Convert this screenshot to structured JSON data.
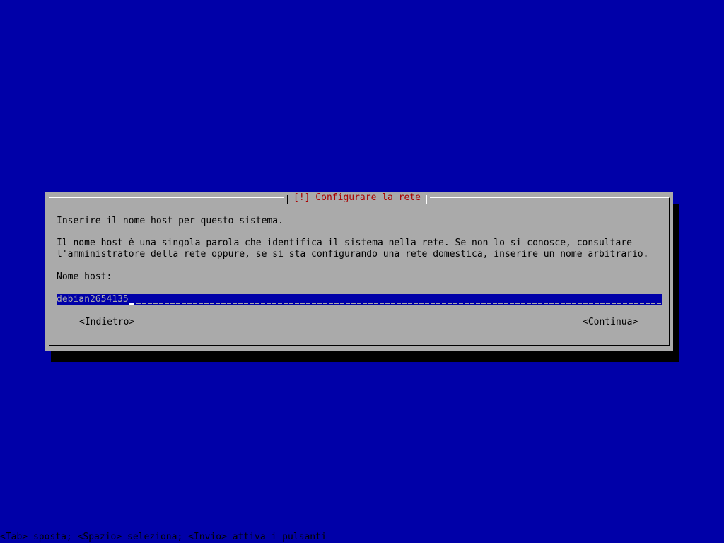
{
  "dialog": {
    "title": "[!] Configurare la rete",
    "prompt": "Inserire il nome host per questo sistema.",
    "description_line1": "Il nome host è una singola parola che identifica il sistema nella rete. Se non lo si conosce, consultare",
    "description_line2": "l'amministratore della rete oppure, se si sta configurando una rete domestica, inserire un nome arbitrario.",
    "field_label": "Nome host:",
    "hostname_value": "debian2654135",
    "back_button": "<Indietro>",
    "continue_button": "<Continua>"
  },
  "statusbar": {
    "help": "<Tab> sposta; <Spazio> seleziona; <Invio> attiva i pulsanti"
  },
  "colors": {
    "background": "#0000a8",
    "dialog": "#aaaaaa",
    "title": "#a80000",
    "shadow": "#000000"
  }
}
